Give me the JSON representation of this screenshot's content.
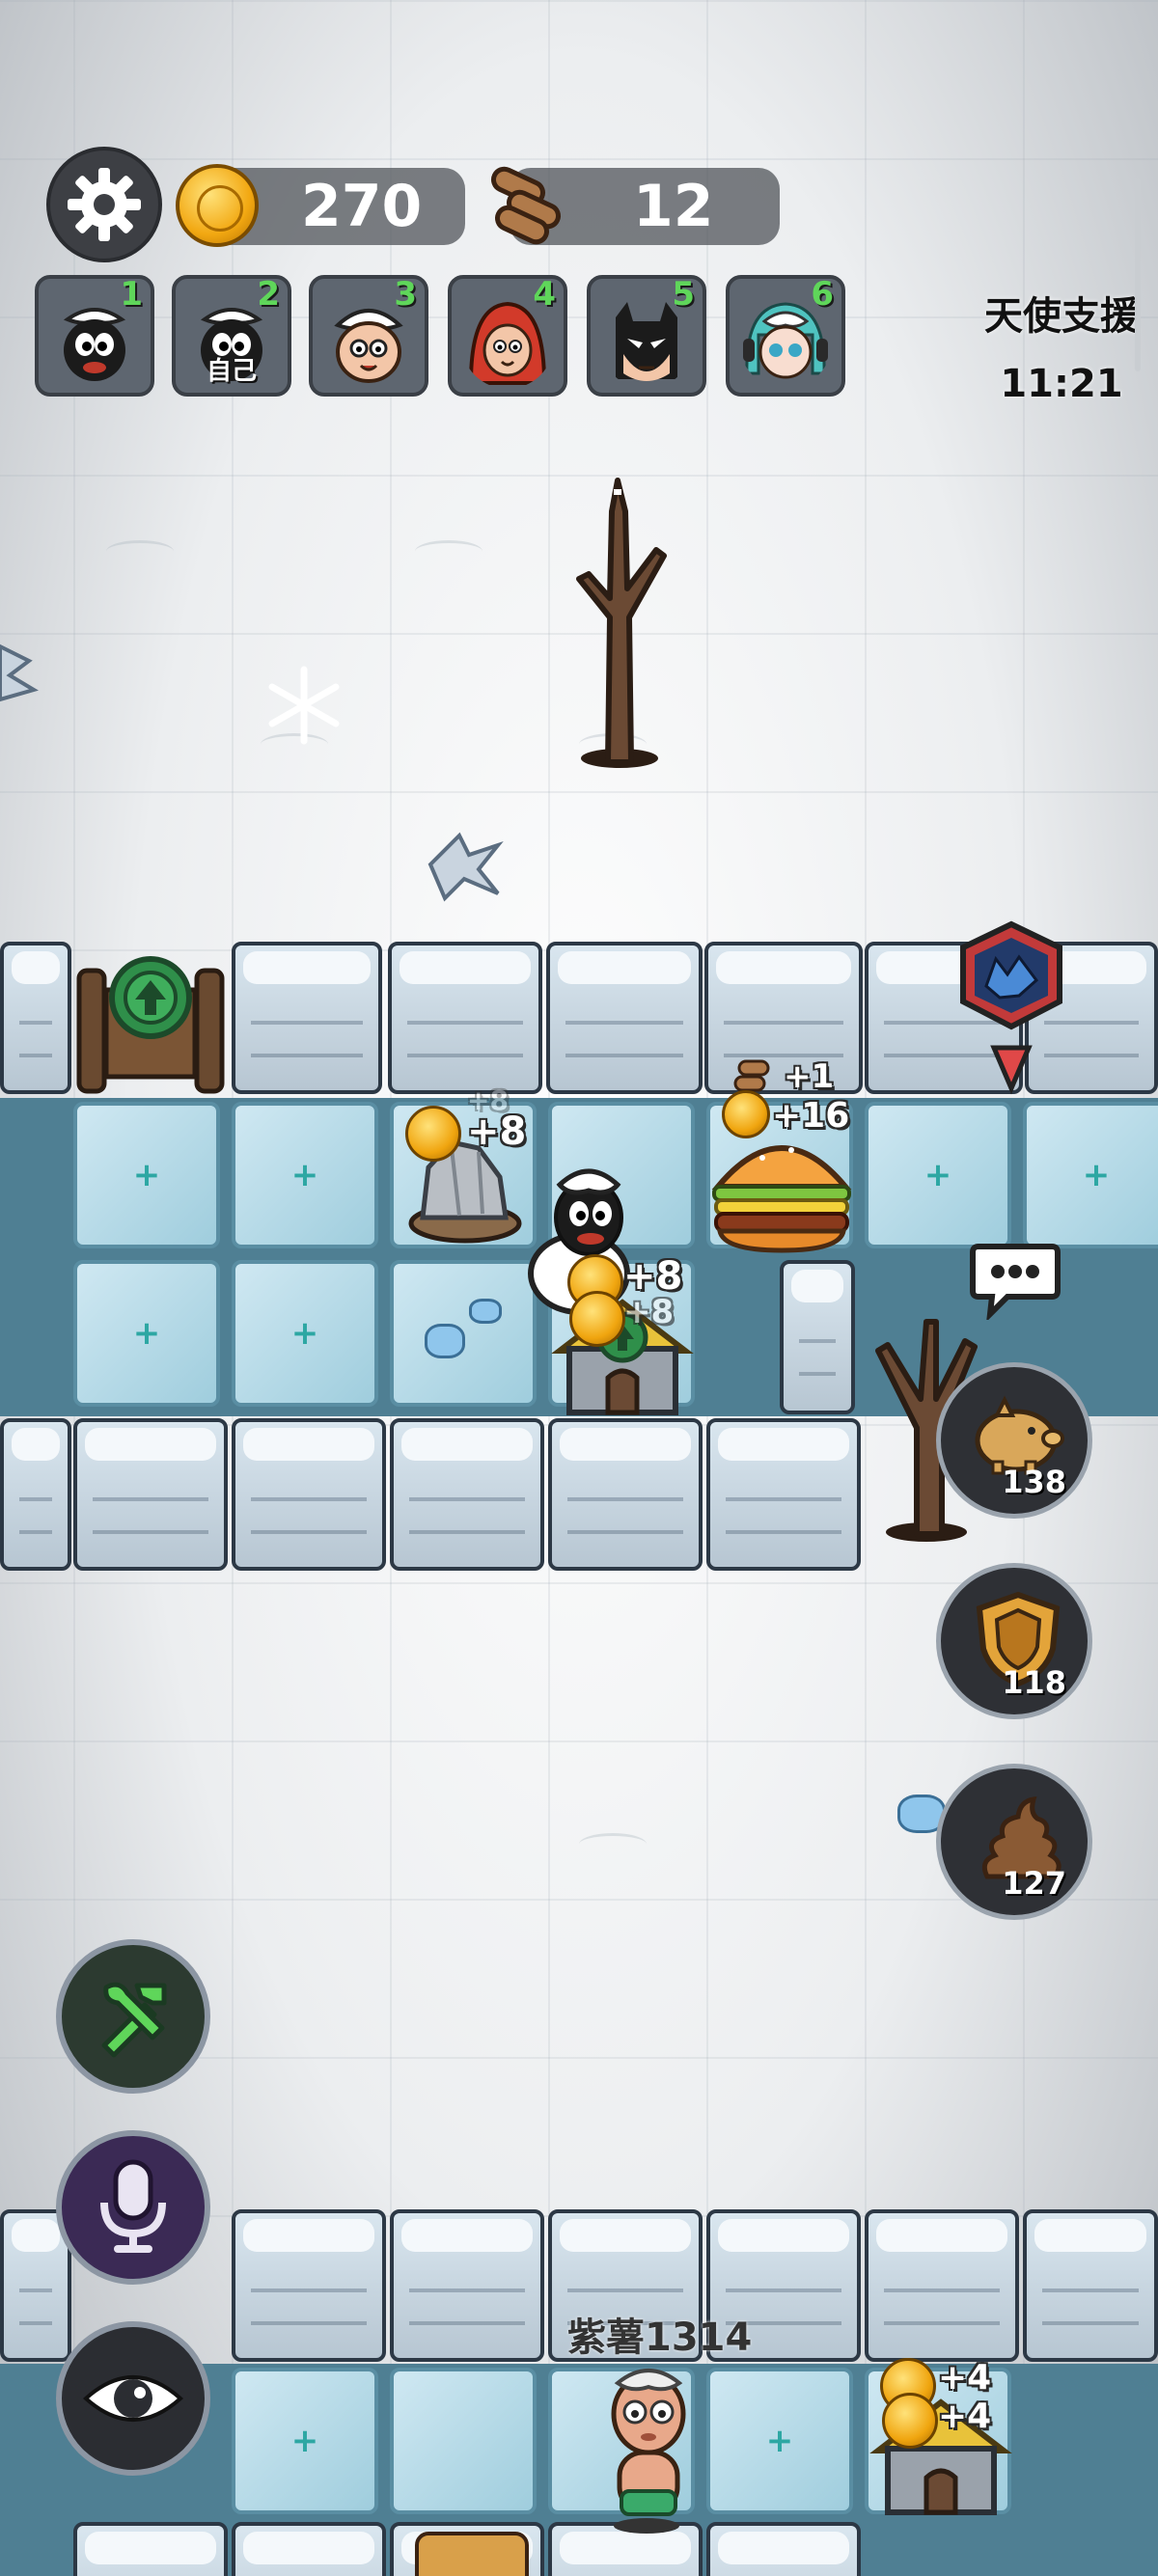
{
  "hud": {
    "coins": "270",
    "wood": "12",
    "players": [
      {
        "num": "1",
        "label": ""
      },
      {
        "num": "2",
        "label": "自己"
      },
      {
        "num": "3",
        "label": ""
      },
      {
        "num": "4",
        "label": ""
      },
      {
        "num": "5",
        "label": ""
      },
      {
        "num": "6",
        "label": ""
      }
    ],
    "angel_support": {
      "title": "天使支援",
      "timer": "11:21"
    }
  },
  "board": {
    "popups": {
      "rock_coin": "+8",
      "rock_coin_ghost": "+8",
      "burger_wood": "+1",
      "burger_coin": "+16",
      "house_coin_a": "+8",
      "house_coin_b": "+8",
      "bottom_house_a": "+4",
      "bottom_house_b": "+4"
    },
    "player_name": "紫薯1314"
  },
  "side_stats": {
    "piggy_bank": "138",
    "shield": "118",
    "poop": "127"
  },
  "colors": {
    "coin": "#f2a812",
    "badge_green": "#5fd65a",
    "upgrade_green": "#2f8f4a"
  },
  "icons": {
    "settings": "gear-icon",
    "build": "hammer-wrench-icon",
    "voice": "microphone-icon",
    "view": "eye-icon",
    "chat": "speech-bubble-icon",
    "enemy": "wolf-icon"
  }
}
